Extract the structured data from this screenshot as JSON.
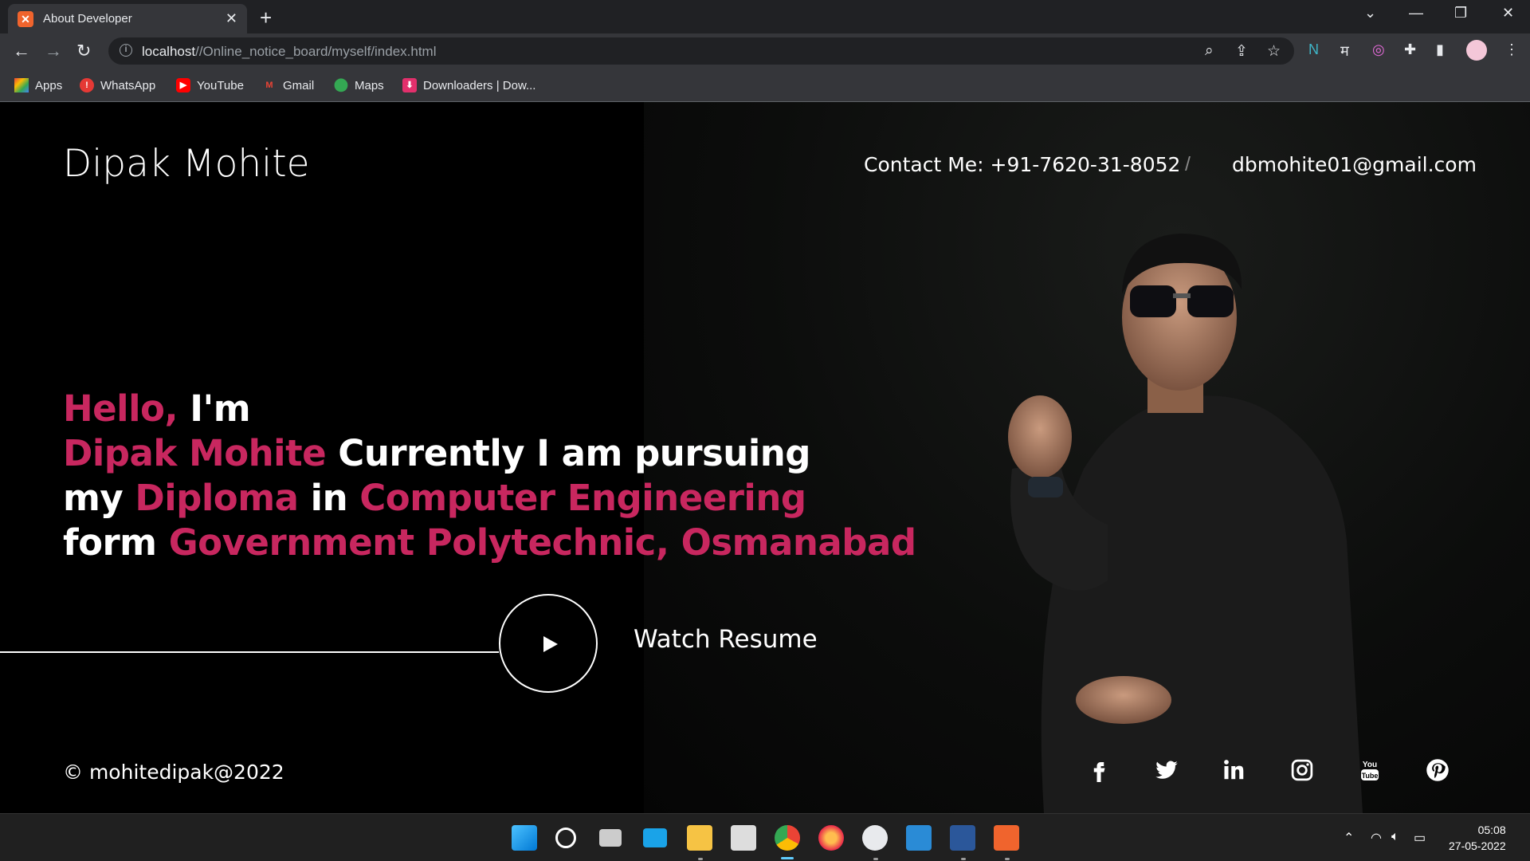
{
  "browser": {
    "tab_title": "About Developer",
    "url_host": "localhost",
    "url_path": "//Online_notice_board/myself/index.html",
    "bookmarks": [
      "Apps",
      "WhatsApp",
      "YouTube",
      "Gmail",
      "Maps",
      "Downloaders | Dow..."
    ]
  },
  "page": {
    "brand": "Dipak Mohite",
    "contact_phone": "Contact Me: +91-7620-31-8052",
    "contact_separator": "/",
    "contact_email": "dbmohite01@gmail.com",
    "hero": {
      "l1_pink": "Hello,",
      "l1_white": " I'm",
      "l2_pink": "Dipak Mohite",
      "l2_white": " Currently I am pursuing",
      "l3_white_a": "my ",
      "l3_pink_a": "Diploma",
      "l3_white_b": " in ",
      "l3_pink_b": "Computer Engineering",
      "l4_white": "form ",
      "l4_pink": "Government Polytechnic, Osmanabad"
    },
    "watch_label": "Watch Resume",
    "copyright": "© mohitedipak@2022",
    "social": [
      "facebook-icon",
      "twitter-icon",
      "linkedin-icon",
      "instagram-icon",
      "youtube-icon",
      "pinterest-icon"
    ],
    "youtube_icon_text_top": "You",
    "youtube_icon_text_bottom": "Tube"
  },
  "taskbar": {
    "time": "05:08",
    "date": "27-05-2022"
  },
  "colors": {
    "accent_pink": "#c8275f",
    "background": "#000000",
    "chrome_dark": "#202124",
    "chrome_toolbar": "#35363a"
  }
}
